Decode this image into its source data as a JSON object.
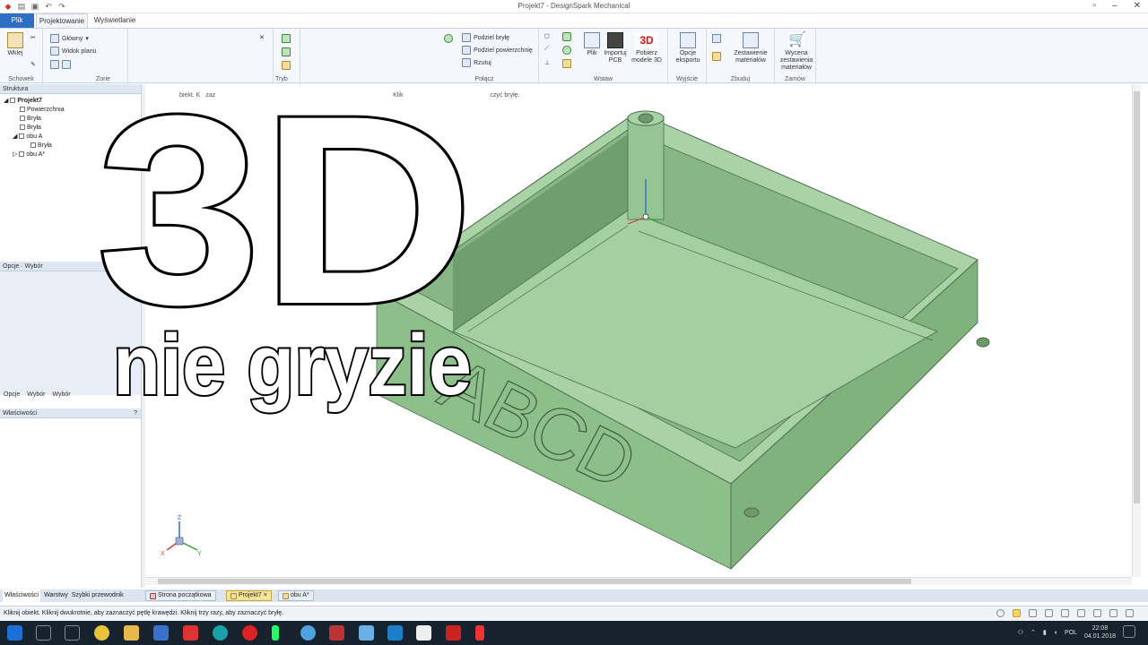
{
  "window": {
    "title": "Projekt7 - DesignSpark Mechanical"
  },
  "ribbon_tabs": {
    "file": "Plik",
    "design": "Projektowanie",
    "view": "Wyświetlanie"
  },
  "ribbon": {
    "clipboard": {
      "paste": "Wklej",
      "label": "Schowek"
    },
    "orient": {
      "home": "Główny",
      "plan": "Widok planu",
      "label": "Zorie"
    },
    "modes": {
      "label": "Tryb"
    },
    "combine": {
      "split_body": "Podziel bryłę",
      "split_surface": "Podziel powierzchnię",
      "project": "Rzutuj",
      "label": "Połącz"
    },
    "insert": {
      "file": "Plik",
      "import_pcb": "Importuj PCB",
      "models_3d": "Pobierz modele 3D",
      "label": "Wstaw"
    },
    "output": {
      "export": "Opcje eksportu",
      "label": "Wyjście"
    },
    "build": {
      "bom": "Zestawienie materiałów",
      "label": "Zbuduj"
    },
    "order": {
      "quote": "Wycena zestawienia materiałów",
      "label": "Zamów"
    }
  },
  "structure": {
    "header": "Struktura",
    "items": [
      "Projekt7",
      "Powierzchnia",
      "Bryła",
      "Bryła",
      "obu A",
      "Bryła",
      "obu A*"
    ]
  },
  "options_panel": {
    "header": "Opcje · Wybór",
    "tabs": [
      "Opcje",
      "Wybór",
      "Wybór"
    ]
  },
  "properties_panel": {
    "header": "Właściwości",
    "help": "?"
  },
  "viewport": {
    "hint_left": "biekt. K",
    "hint_mid": "zaz",
    "hint_right_a": "Klik",
    "hint_right_b": "czyć bryłę.",
    "engraving": "ABCD",
    "axis_labels": {
      "x": "X",
      "y": "Y",
      "z": "Z"
    }
  },
  "overlay_text": {
    "big": "3D",
    "sub": "nie gryzie"
  },
  "left_bottom_tabs": [
    "Właściwości",
    "Warstwy",
    "Szybki przewodnik"
  ],
  "doc_tabs": [
    "Strona początkowa",
    "Projekt7",
    "obu A*"
  ],
  "status": {
    "text": "Kliknij obiekt. Kliknij dwukrotnie, aby zaznaczyć pętlę krawędzi. Kliknij trzy razy, aby zaznaczyć bryłę."
  },
  "taskbar": {
    "lang": "POL",
    "time": "22:08",
    "date": "04.01.2018"
  },
  "colors": {
    "model_fill": "#9fcd9d",
    "model_dark": "#83b482",
    "model_edge": "#4f6c4f",
    "accent": "#2c6fc3"
  }
}
